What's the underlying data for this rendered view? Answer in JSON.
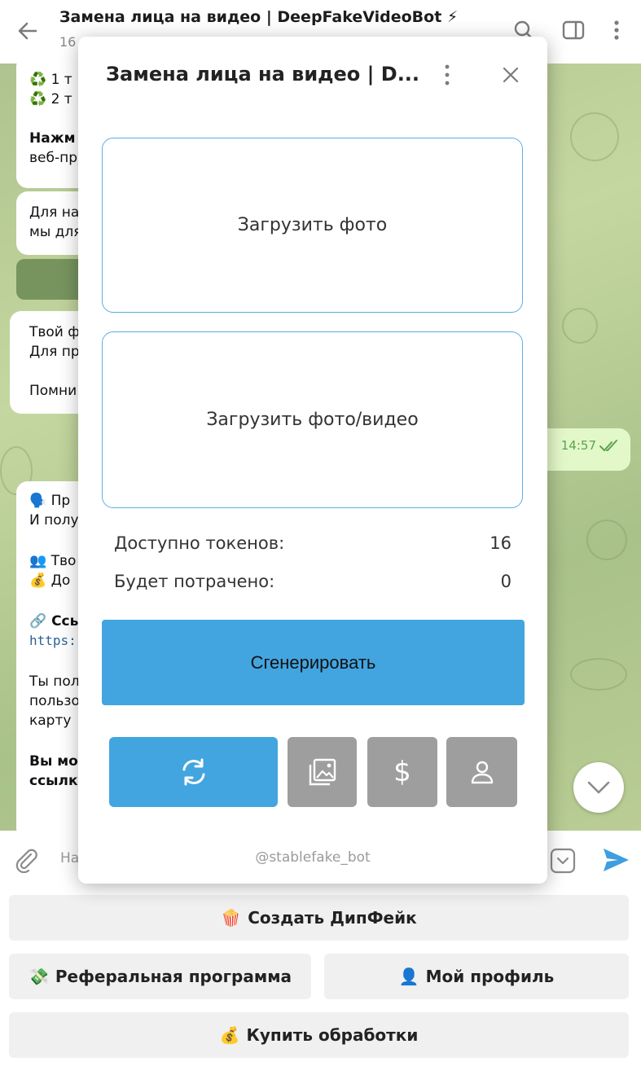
{
  "header": {
    "title": "Замена лица на видео | DeepFakeVideoBot ⚡",
    "subtitle": "16"
  },
  "chat": {
    "msg1": {
      "line1": "♻️ 1 т",
      "line2": "♻️ 2 т",
      "line3": "Нажм",
      "line4": "веб-пр"
    },
    "msg2": {
      "line1": "Для на",
      "line2": "мы для"
    },
    "msg3": {
      "line1": "Твой ф",
      "line2": "Для пр",
      "line3": "Помни"
    },
    "out_time": "14:57",
    "msg4": {
      "line1": "🗣️ Пр",
      "line2": "И полу",
      "line3": "👥 Тво",
      "line4": "💰 До",
      "line5": "🔗 Ссь",
      "line6": "https:",
      "line7": "Ты пол",
      "line8": "пользо",
      "line9": "карту",
      "line10": "Вы мо",
      "line11": "ссылку"
    }
  },
  "input": {
    "placeholder": "На"
  },
  "keyboard": {
    "create": {
      "emoji": "🍿",
      "label": "Создать ДипФейк"
    },
    "referral": {
      "emoji": "💸",
      "label": "Реферальная программа"
    },
    "profile": {
      "emoji": "👤",
      "label": "Мой профиль"
    },
    "buy": {
      "emoji": "💰",
      "label": "Купить обработки"
    }
  },
  "mini_app": {
    "title": "Замена лица на видео | D...",
    "upload_photo": "Загрузить фото",
    "upload_media": "Загрузить фото/видео",
    "tokens_label": "Доступно токенов:",
    "tokens_value": "16",
    "spend_label": "Будет потрачено:",
    "spend_value": "0",
    "generate_label": "Сгенерировать",
    "dollar_symbol": "$",
    "footer": "@stablefake_bot"
  },
  "colors": {
    "accent": "#42a5e0",
    "inactive_tab": "#9e9e9e",
    "upload_border": "#5aaee6",
    "chat_bg": "#b9cd94"
  },
  "icons": {
    "back": "arrow-left-icon",
    "search": "search-icon",
    "sidebar": "sidebar-toggle-icon",
    "more": "more-vertical-icon",
    "close": "close-icon",
    "refresh": "refresh-icon",
    "gallery": "gallery-icon",
    "dollar": "dollar-icon",
    "user": "user-icon",
    "attach": "paperclip-icon",
    "keyboard": "keyboard-toggle-icon",
    "send": "send-icon",
    "scroll": "chevron-down-icon"
  }
}
